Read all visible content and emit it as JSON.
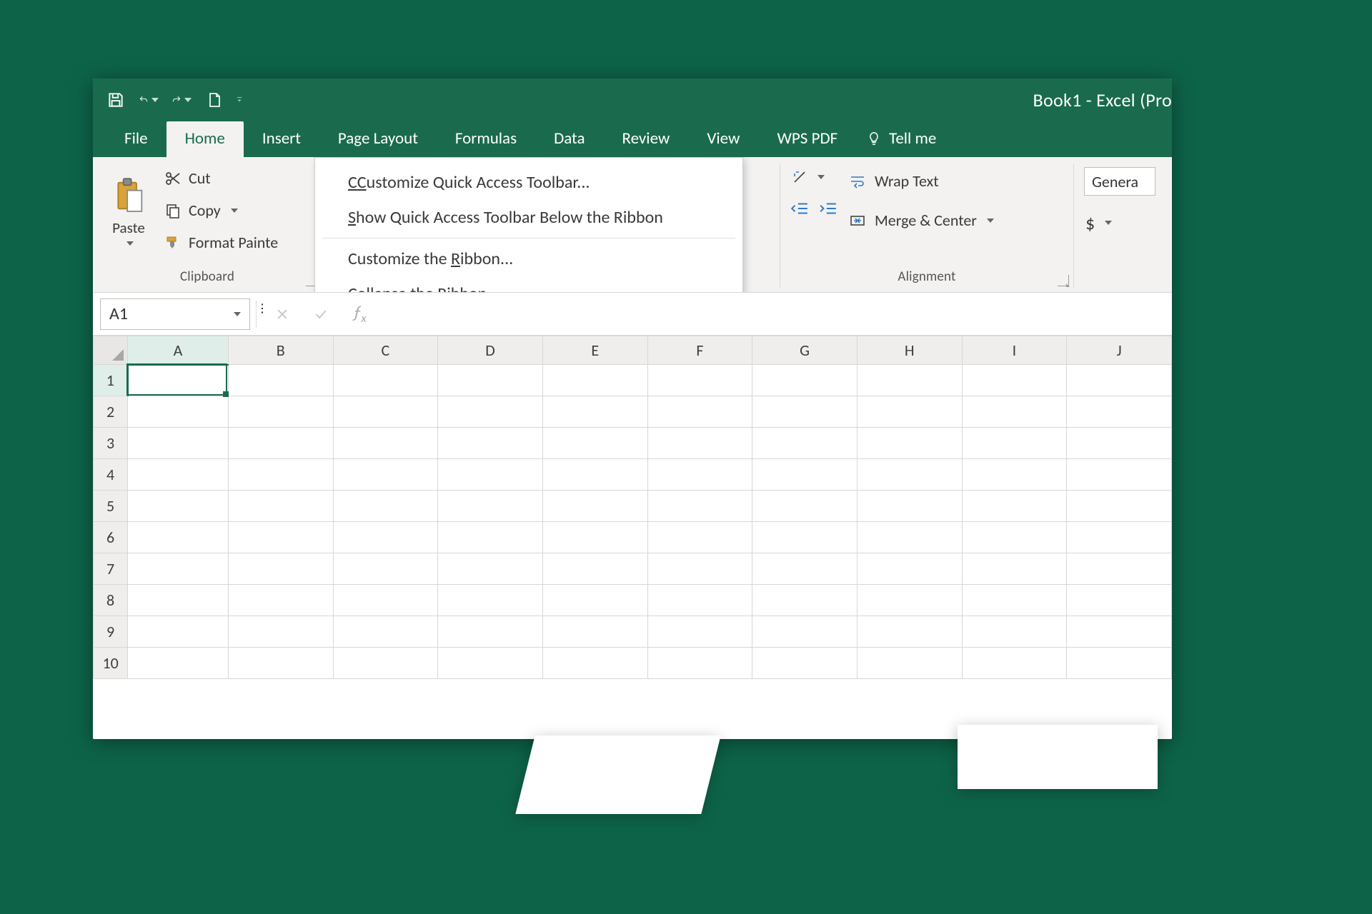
{
  "app": {
    "title": "Book1 - Excel (Pro"
  },
  "tabs": {
    "file": "File",
    "home": "Home",
    "insert": "Insert",
    "page_layout": "Page Layout",
    "formulas": "Formulas",
    "data": "Data",
    "review": "Review",
    "view": "View",
    "wps_pdf": "WPS PDF",
    "tell_me": "Tell me"
  },
  "ribbon": {
    "clipboard": {
      "paste": "Paste",
      "cut": "Cut",
      "copy": "Copy",
      "format_painter": "Format Painte",
      "group_label": "Clipboard"
    },
    "alignment": {
      "wrap_text": "Wrap Text",
      "merge_center": "Merge & Center",
      "group_label": "Alignment"
    },
    "number": {
      "format": "Genera",
      "currency": "$"
    }
  },
  "context_menu": {
    "customize_qat": "Customize Quick Access Toolbar...",
    "show_qat_below": "Show Quick Access Toolbar Below the Ribbon",
    "customize_ribbon": "Customize the Ribbon...",
    "collapse_ribbon": "Collapse the Ribbon"
  },
  "formula_bar": {
    "name_box": "A1",
    "fx": "fx",
    "formula": ""
  },
  "grid": {
    "columns": [
      "A",
      "B",
      "C",
      "D",
      "E",
      "F",
      "G",
      "H",
      "I",
      "J"
    ],
    "rows": [
      "1",
      "2",
      "3",
      "4",
      "5",
      "6",
      "7",
      "8",
      "9",
      "10"
    ],
    "active_col": "A",
    "active_row": "1"
  }
}
